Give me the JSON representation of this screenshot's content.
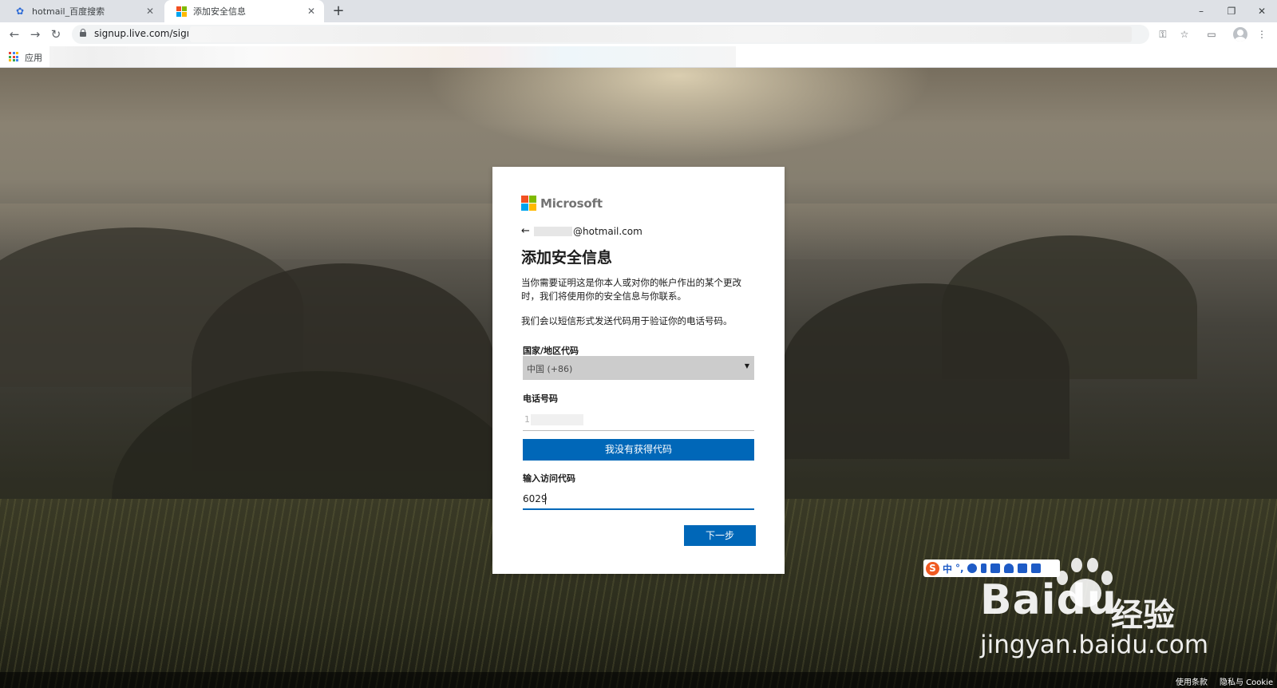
{
  "browser": {
    "tabs": [
      {
        "title": "hotmail_百度搜索",
        "active": false,
        "favicon": "baidu-paw-icon"
      },
      {
        "title": "添加安全信息",
        "active": true,
        "favicon": "microsoft-logo-icon"
      }
    ],
    "new_tab": "+",
    "url": "signup.live.com/signu",
    "window_controls": {
      "minimize": "–",
      "restore": "❐",
      "close": "✕"
    },
    "bookmarks": {
      "apps_label": "应用"
    }
  },
  "card": {
    "brand": "Microsoft",
    "identity": "@hotmail.com",
    "back_arrow": "←",
    "heading": "添加安全信息",
    "description": "当你需要证明这是你本人或对你的帐户作出的某个更改时，我们将使用你的安全信息与你联系。",
    "sms_note": "我们会以短信形式发送代码用于验证你的电话号码。",
    "country_label": "国家/地区代码",
    "country_value": "中国 (+86)",
    "phone_label": "电话号码",
    "phone_value_prefix": "1",
    "resend_button": "我没有获得代码",
    "code_label": "输入访问代码",
    "code_value": "6029",
    "next_button": "下一步"
  },
  "footer": {
    "terms": "使用条款",
    "privacy": "隐私与 Cookie"
  },
  "ime": {
    "mode": "中",
    "punct": "°,"
  },
  "watermark": {
    "brand": "Bai",
    "brand2": "du",
    "cn": "经验",
    "url": "jingyan.baidu.com"
  },
  "colors": {
    "primary": "#0067b8",
    "ms_red": "#f25022",
    "ms_green": "#7fba00",
    "ms_blue": "#00a4ef",
    "ms_yellow": "#ffb900"
  }
}
